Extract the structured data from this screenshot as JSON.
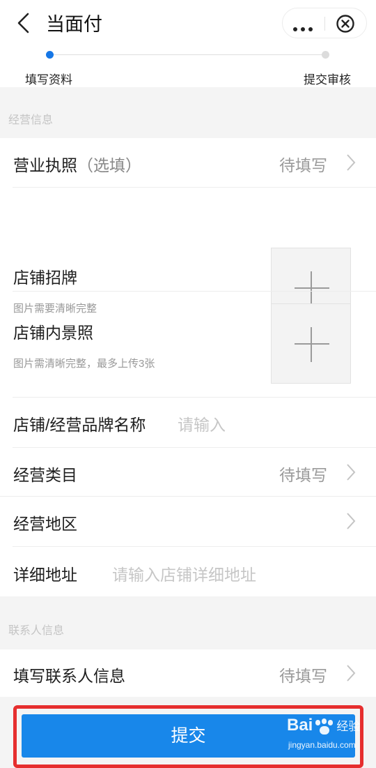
{
  "header": {
    "title": "当面付",
    "back_icon": "chevron-left-icon",
    "more_icon": "more-dots-icon",
    "close_icon": "close-circle-icon"
  },
  "progress": {
    "steps": [
      "填写资料",
      "提交审核"
    ],
    "active_index": 0,
    "active_color": "#1677e6"
  },
  "business": {
    "section_title": "经营信息",
    "license": {
      "label": "营业执照",
      "optional": "（选填）",
      "value": "待填写"
    },
    "signboard": {
      "label": "店铺招牌",
      "hint": "图片需要清晰完整"
    },
    "interior": {
      "label": "店铺内景照",
      "hint": "图片需清晰完整，最多上传3张"
    },
    "brand_name": {
      "label": "店铺/经营品牌名称",
      "placeholder": "请输入"
    },
    "category": {
      "label": "经营类目",
      "value": "待填写"
    },
    "region": {
      "label": "经营地区"
    },
    "address": {
      "label": "详细地址",
      "placeholder": "请输入店铺详细地址"
    }
  },
  "contact": {
    "section_title": "联系人信息",
    "info": {
      "label": "填写联系人信息",
      "value": "待填写"
    }
  },
  "submit": {
    "label": "提交",
    "color": "#1887ea",
    "highlight_color": "#e62e2e"
  },
  "watermark": {
    "brand_left": "Bai",
    "brand_right": "经验",
    "url": "jingyan.baidu.com"
  }
}
